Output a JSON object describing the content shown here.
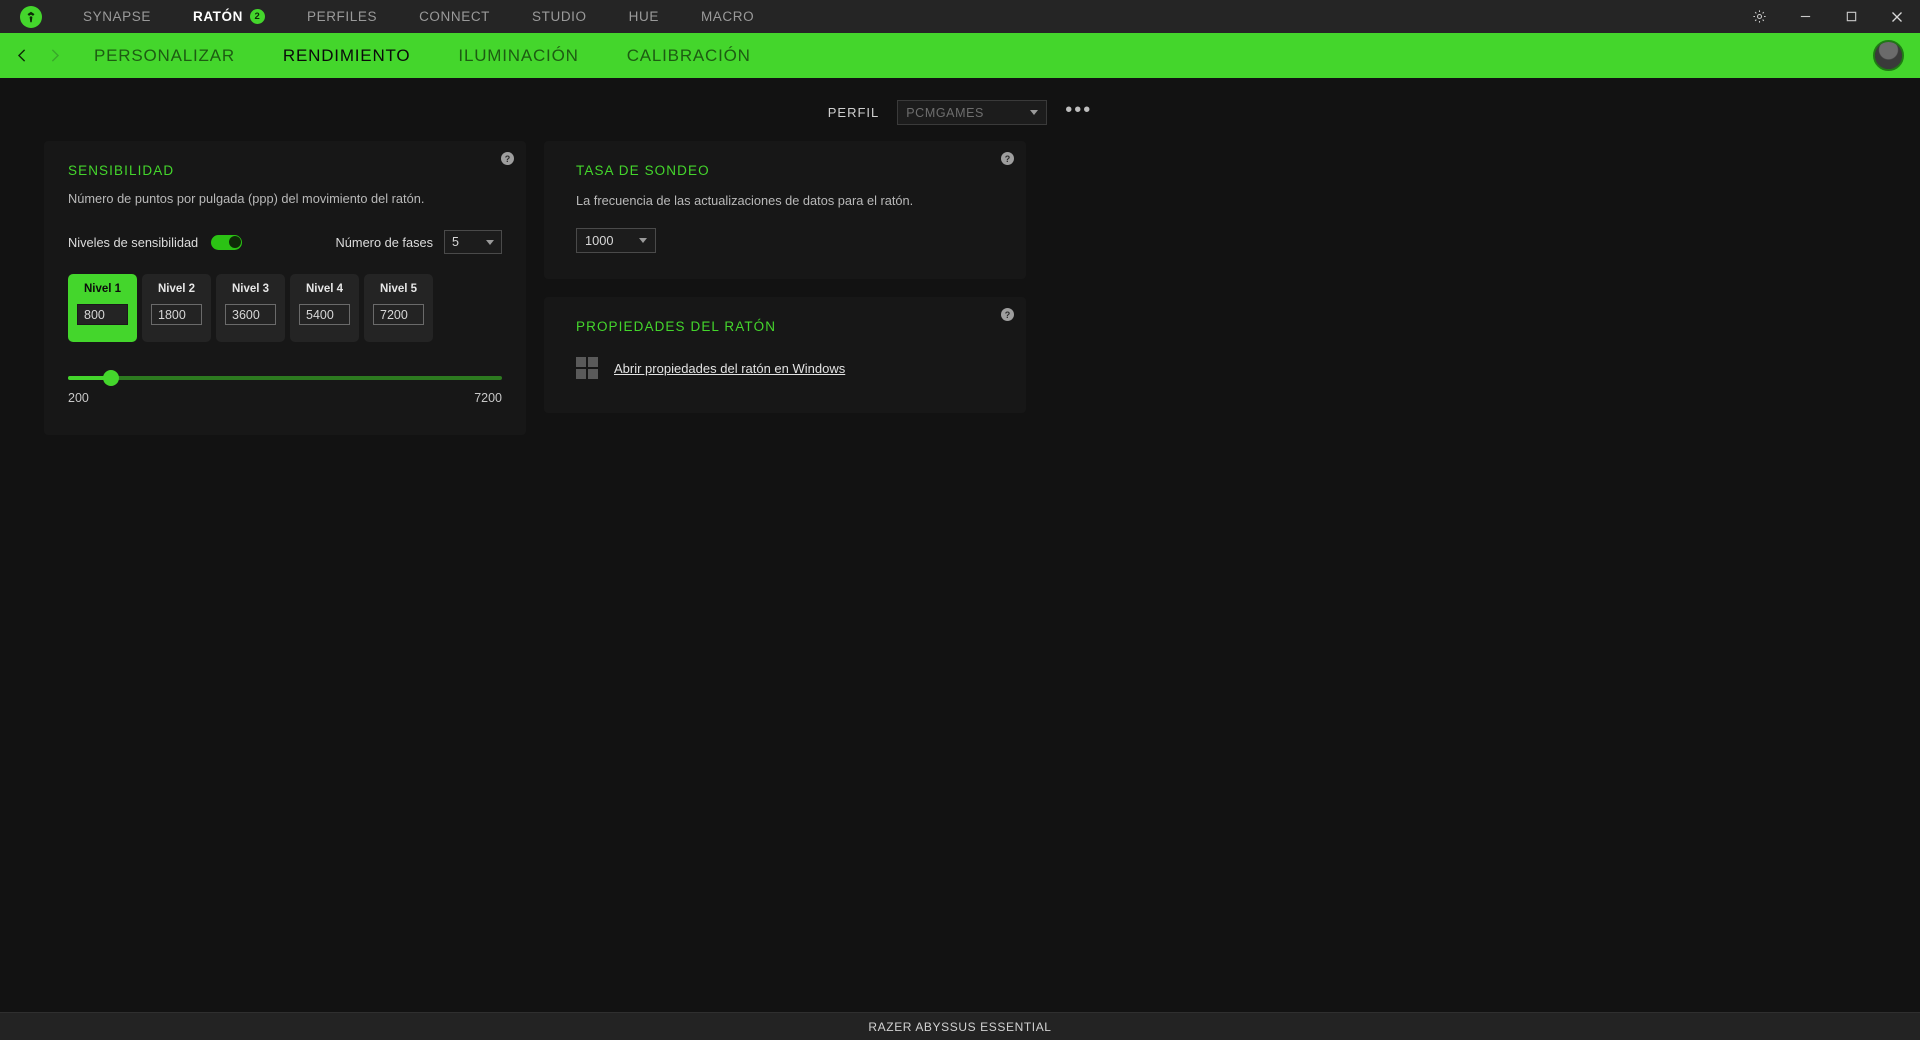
{
  "window": {
    "titlebar": {
      "logo_icon": "razer-logo-icon",
      "nav": [
        {
          "label": "SYNAPSE",
          "active": false,
          "badge": ""
        },
        {
          "label": "RATÓN",
          "active": true,
          "badge": "2"
        },
        {
          "label": "PERFILES",
          "active": false,
          "badge": ""
        },
        {
          "label": "CONNECT",
          "active": false,
          "badge": ""
        },
        {
          "label": "STUDIO",
          "active": false,
          "badge": ""
        },
        {
          "label": "HUE",
          "active": false,
          "badge": ""
        },
        {
          "label": "MACRO",
          "active": false,
          "badge": ""
        }
      ],
      "controls": {
        "settings_icon": "gear-icon",
        "minimize_icon": "minimize-icon",
        "maximize_icon": "maximize-icon",
        "close_icon": "close-icon"
      }
    },
    "subnav": {
      "back_icon": "chevron-left-icon",
      "forward_icon": "chevron-right-icon",
      "tabs": [
        {
          "label": "PERSONALIZAR",
          "active": false
        },
        {
          "label": "RENDIMIENTO",
          "active": true
        },
        {
          "label": "ILUMINACIÓN",
          "active": false
        },
        {
          "label": "CALIBRACIÓN",
          "active": false
        }
      ],
      "avatar_icon": "user-avatar-icon"
    }
  },
  "profile": {
    "label": "PERFIL",
    "selected": "PCMGAMES",
    "dropdown_icon": "chevron-down-icon",
    "more_label": "•••"
  },
  "sensitivity": {
    "title": "SENSIBILIDAD",
    "description": "Número de puntos por pulgada (ppp) del movimiento del ratón.",
    "help_icon": "help-icon",
    "toggle_label": "Niveles de sensibilidad",
    "toggle_on": true,
    "stages_label": "Número de fases",
    "stages_value": "5",
    "levels": [
      {
        "name": "Nivel 1",
        "value": "800",
        "active": true
      },
      {
        "name": "Nivel 2",
        "value": "1800",
        "active": false
      },
      {
        "name": "Nivel 3",
        "value": "3600",
        "active": false
      },
      {
        "name": "Nivel 4",
        "value": "5400",
        "active": false
      },
      {
        "name": "Nivel 5",
        "value": "7200",
        "active": false
      }
    ],
    "slider": {
      "min_label": "200",
      "max_label": "7200",
      "min": 200,
      "max": 7200,
      "value": 800,
      "percent": 10
    }
  },
  "polling": {
    "title": "TASA DE SONDEO",
    "description": "La frecuencia de las actualizaciones de datos para el ratón.",
    "help_icon": "help-icon",
    "selected": "1000",
    "dropdown_icon": "chevron-down-icon"
  },
  "mouse_properties": {
    "title": "PROPIEDADES DEL RATÓN",
    "help_icon": "help-icon",
    "windows_icon": "windows-logo-icon",
    "link_label": "Abrir propiedades del ratón en Windows"
  },
  "footer": {
    "device": "RAZER ABYSSUS ESSENTIAL"
  },
  "colors": {
    "razer_green": "#44d62c",
    "background": "#121212",
    "card": "#171717",
    "titlebar": "#252525"
  }
}
